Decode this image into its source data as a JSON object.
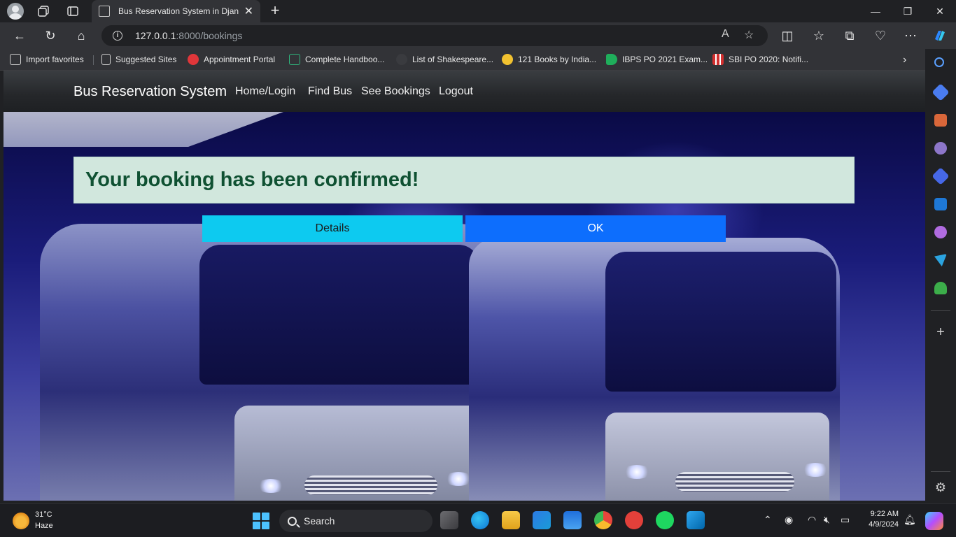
{
  "browser": {
    "tab_title": "Bus Reservation System in Djang",
    "url_host": "127.0.0.1",
    "url_rest": ":8000/bookings",
    "favorites": [
      {
        "label": "Import favorites",
        "icon": "import-icon"
      },
      {
        "label": "Suggested Sites",
        "icon": "page-icon"
      },
      {
        "label": "Appointment Portal",
        "icon": "wifi-signal-icon"
      },
      {
        "label": "Complete Handboo...",
        "icon": "book-icon"
      },
      {
        "label": "List of Shakespeare...",
        "icon": "dot-icon"
      },
      {
        "label": "121 Books by India...",
        "icon": "circle-logo-icon"
      },
      {
        "label": "IBPS PO 2021 Exam...",
        "icon": "flag-icon"
      },
      {
        "label": "SBI PO 2020: Notifi...",
        "icon": "grid-logo-icon"
      }
    ]
  },
  "app": {
    "brand": "Bus Reservation System",
    "nav": [
      "Home/Login",
      "Find Bus",
      "See Bookings",
      "Logout"
    ],
    "alert": "Your booking has been confirmed!",
    "details_button": "Details",
    "ok_button": "OK"
  },
  "taskbar": {
    "temperature": "31°C",
    "condition": "Haze",
    "search_label": "Search",
    "time": "9:22 AM",
    "date": "4/9/2024"
  },
  "colors": {
    "alert_bg": "#d1e7dd",
    "alert_text": "#0f5132",
    "details_btn": "#0dcaf0",
    "ok_btn": "#0d6efd",
    "navbar": "#2a2c2f"
  }
}
